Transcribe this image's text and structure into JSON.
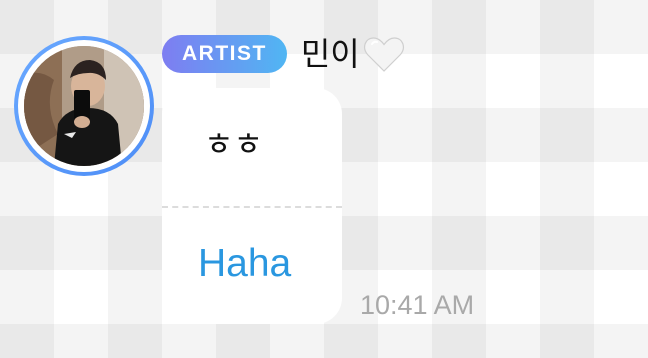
{
  "message": {
    "badge": "ARTIST",
    "sender": "민이",
    "sender_icon": "white-heart-icon",
    "original_text": "ㅎㅎ",
    "translated_text": "Haha",
    "time": "10:41 AM"
  },
  "colors": {
    "badge_gradient_start": "#7e7df1",
    "badge_gradient_end": "#50b6f3",
    "translation_text": "#2a97e0",
    "avatar_ring": "#5a9bf7",
    "timestamp": "#a9a9a9"
  }
}
